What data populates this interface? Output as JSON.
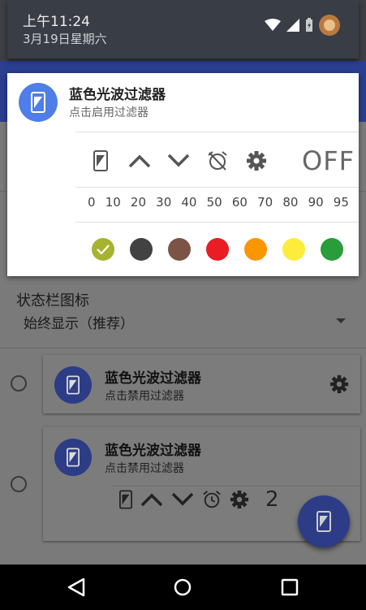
{
  "statusbar": {
    "time": "上午11:24",
    "date": "3月19日星期六"
  },
  "notification": {
    "title": "蓝色光波过滤器",
    "subtitle": "点击启用过滤器",
    "off_label": "OFF",
    "levels": [
      "0",
      "10",
      "20",
      "30",
      "40",
      "50",
      "60",
      "70",
      "80",
      "90",
      "95"
    ],
    "colors": [
      {
        "name": "olive",
        "hex": "#a5b331",
        "selected": true
      },
      {
        "name": "dark-gray",
        "hex": "#424242"
      },
      {
        "name": "brown",
        "hex": "#7b5446"
      },
      {
        "name": "red",
        "hex": "#ea1c24"
      },
      {
        "name": "orange",
        "hex": "#fb9603"
      },
      {
        "name": "yellow",
        "hex": "#ffeb3c"
      },
      {
        "name": "green",
        "hex": "#289d3a"
      }
    ]
  },
  "settings": {
    "status_icon_label": "状态栏图标",
    "status_icon_value": "始终显示（推荐）"
  },
  "styles": [
    {
      "title": "蓝色光波过滤器",
      "subtitle": "点击禁用过滤器"
    },
    {
      "title": "蓝色光波过滤器",
      "subtitle": "点击禁用过滤器"
    }
  ],
  "card2_partial_text": "2"
}
